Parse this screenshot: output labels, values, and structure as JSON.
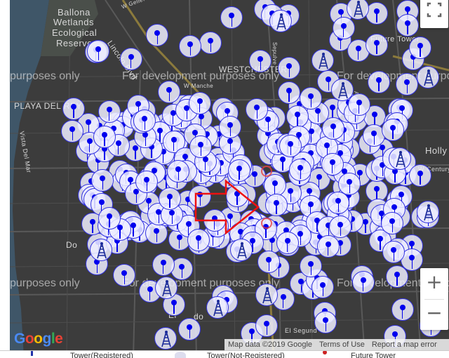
{
  "map": {
    "place_labels": [
      {
        "text": "Ballona",
        "size": 13
      },
      {
        "text": "Wetlands",
        "size": 13
      },
      {
        "text": "Ecological",
        "size": 13
      },
      {
        "text": "Reserve",
        "size": 13
      },
      {
        "text": "Lincoln Blvd",
        "size": 11
      },
      {
        "text": "WESTCHESTER",
        "size": 12
      },
      {
        "text": "PLAYA DEL REY",
        "size": 12
      },
      {
        "text": "Vista Del Mar",
        "size": 9
      },
      {
        "text": "Future Tower",
        "size": 11
      },
      {
        "text": "Holly",
        "size": 13
      },
      {
        "text": "W Century",
        "size": 9
      },
      {
        "text": "El",
        "size": 12
      },
      {
        "text": "do",
        "size": 12
      },
      {
        "text": "Do",
        "size": 12
      },
      {
        "text": "El Segund",
        "size": 9
      },
      {
        "text": "W Manche",
        "size": 8
      },
      {
        "text": "Sepulve",
        "size": 8
      },
      {
        "text": "Aviat",
        "size": 8
      },
      {
        "text": "W Gellef",
        "size": 8
      }
    ],
    "watermarks": [
      "purposes only",
      "For development purposes only",
      "For development purposes only",
      "purposes only",
      "For development purposes only",
      "For development purposes only"
    ]
  },
  "controls": {
    "fullscreen_icon": "fullscreen-icon",
    "zoom_in": "+",
    "zoom_out": "−"
  },
  "attribution": {
    "map_data": "Map data ©2019 Google",
    "terms": "Terms of Use",
    "report": "Report a map error"
  },
  "logo": {
    "text": "Google"
  },
  "legend": {
    "items": [
      {
        "label": "Tower(Registered)",
        "icon": "blue-tower-icon"
      },
      {
        "label": "Tower(Not-Registered)",
        "icon": "blue-pin-icon"
      },
      {
        "label": "Future Tower",
        "icon": "red-pin-icon"
      }
    ]
  },
  "colors": {
    "marker_border": "#3434e0",
    "marker_fill": "#eeeeff",
    "marker_pin": "#0000ee",
    "arrow": "#ee1111",
    "map_bg": "#3c3c3c",
    "water": "#3f5668"
  }
}
